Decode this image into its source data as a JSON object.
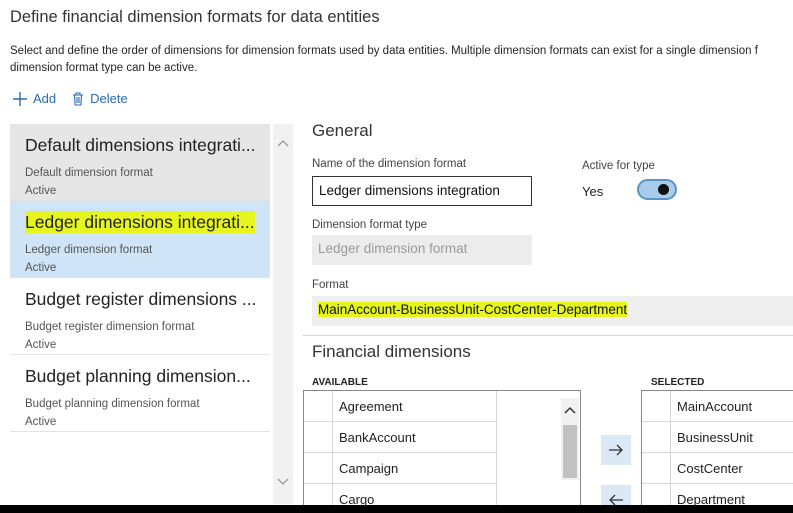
{
  "page": {
    "title": "Define financial dimension formats for data entities",
    "description_line1": "Select and define the order of dimensions for dimension formats used by data entities. Multiple dimension formats can exist for a single dimension f",
    "description_line2": "dimension format type can be active."
  },
  "actions": {
    "add_label": "Add",
    "delete_label": "Delete"
  },
  "formats_list": [
    {
      "title": "Default dimensions integrati...",
      "type": "Default dimension format",
      "status": "Active"
    },
    {
      "title": "Ledger dimensions integrati...",
      "type": "Ledger dimension format",
      "status": "Active"
    },
    {
      "title": "Budget register dimensions ...",
      "type": "Budget register dimension format",
      "status": "Active"
    },
    {
      "title": "Budget planning dimension...",
      "type": "Budget planning dimension format",
      "status": "Active"
    }
  ],
  "general": {
    "section_title": "General",
    "name_label": "Name of the dimension format",
    "name_value": "Ledger dimensions integration",
    "active_label": "Active for type",
    "active_value": "Yes",
    "type_label": "Dimension format type",
    "type_value": "Ledger dimension format",
    "format_label": "Format",
    "format_value": "MainAccount-BusinessUnit-CostCenter-Department"
  },
  "financial_dimensions": {
    "section_title": "Financial dimensions",
    "available_header": "AVAILABLE",
    "selected_header": "SELECTED",
    "available": [
      "Agreement",
      "BankAccount",
      "Campaign",
      "Cargo"
    ],
    "selected": [
      "MainAccount",
      "BusinessUnit",
      "CostCenter",
      "Department"
    ]
  },
  "colors": {
    "accent": "#2a6ab4",
    "selected_row": "#cfe4f6",
    "highlight": "#e6f51e"
  },
  "icons": [
    "add-icon",
    "delete-icon",
    "chevron-up-icon",
    "chevron-down-icon",
    "arrow-right-icon",
    "arrow-left-icon"
  ]
}
